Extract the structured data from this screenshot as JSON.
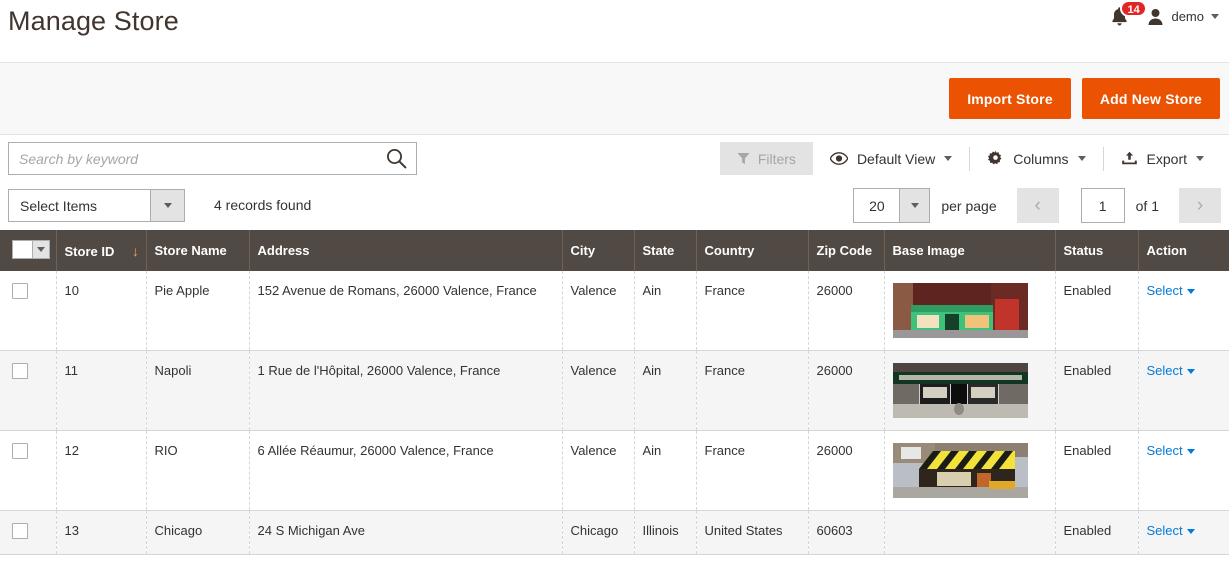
{
  "header": {
    "title": "Manage Store",
    "notifications": {
      "icon": "bell-icon",
      "count": "14"
    },
    "user": {
      "icon": "user-avatar-icon",
      "name": "demo"
    }
  },
  "actions": {
    "import_store": "Import Store",
    "add_new_store": "Add New Store",
    "accent_color": "#eb5202"
  },
  "toolbar": {
    "search_placeholder": "Search by keyword",
    "search_value": "",
    "search_icon": "search-icon",
    "filters_label": "Filters",
    "filters_icon": "filter-funnel-icon",
    "default_view_label": "Default View",
    "default_view_icon": "eye-icon",
    "columns_label": "Columns",
    "columns_icon": "gear-icon",
    "export_label": "Export",
    "export_icon": "export-upload-icon"
  },
  "toolbar2": {
    "select_items_label": "Select Items",
    "records_found": "4 records found",
    "per_page_value": "20",
    "per_page_label": "per page",
    "prev_icon": "chevron-left-icon",
    "next_icon": "chevron-right-icon",
    "page_value": "1",
    "of_pages": "of 1"
  },
  "grid": {
    "columns": [
      {
        "key": "checkbox",
        "label": ""
      },
      {
        "key": "store_id",
        "label": "Store ID",
        "sort": "desc"
      },
      {
        "key": "store_name",
        "label": "Store Name"
      },
      {
        "key": "address",
        "label": "Address"
      },
      {
        "key": "city",
        "label": "City"
      },
      {
        "key": "state",
        "label": "State"
      },
      {
        "key": "country",
        "label": "Country"
      },
      {
        "key": "zip",
        "label": "Zip Code"
      },
      {
        "key": "base_image",
        "label": "Base Image"
      },
      {
        "key": "status",
        "label": "Status"
      },
      {
        "key": "action",
        "label": "Action"
      }
    ],
    "action_label": "Select",
    "rows": [
      {
        "store_id": "10",
        "store_name": "Pie Apple",
        "address": "152 Avenue de Romans, 26000 Valence, France",
        "city": "Valence",
        "state": "Ain",
        "country": "France",
        "zip": "26000",
        "has_image": true,
        "image_kind": "green-storefront",
        "status": "Enabled"
      },
      {
        "store_id": "11",
        "store_name": "Napoli",
        "address": "1 Rue de l'Hôpital, 26000 Valence, France",
        "city": "Valence",
        "state": "Ain",
        "country": "France",
        "zip": "26000",
        "has_image": true,
        "image_kind": "brick-storefront",
        "status": "Enabled"
      },
      {
        "store_id": "12",
        "store_name": "RIO",
        "address": "6 Allée Réaumur, 26000 Valence, France",
        "city": "Valence",
        "state": "Ain",
        "country": "France",
        "zip": "26000",
        "has_image": true,
        "image_kind": "yellow-awning-storefront",
        "status": "Enabled"
      },
      {
        "store_id": "13",
        "store_name": "Chicago",
        "address": "24 S Michigan Ave",
        "city": "Chicago",
        "state": "Illinois",
        "country": "United States",
        "zip": "60603",
        "has_image": false,
        "image_kind": "",
        "status": "Enabled"
      }
    ]
  }
}
